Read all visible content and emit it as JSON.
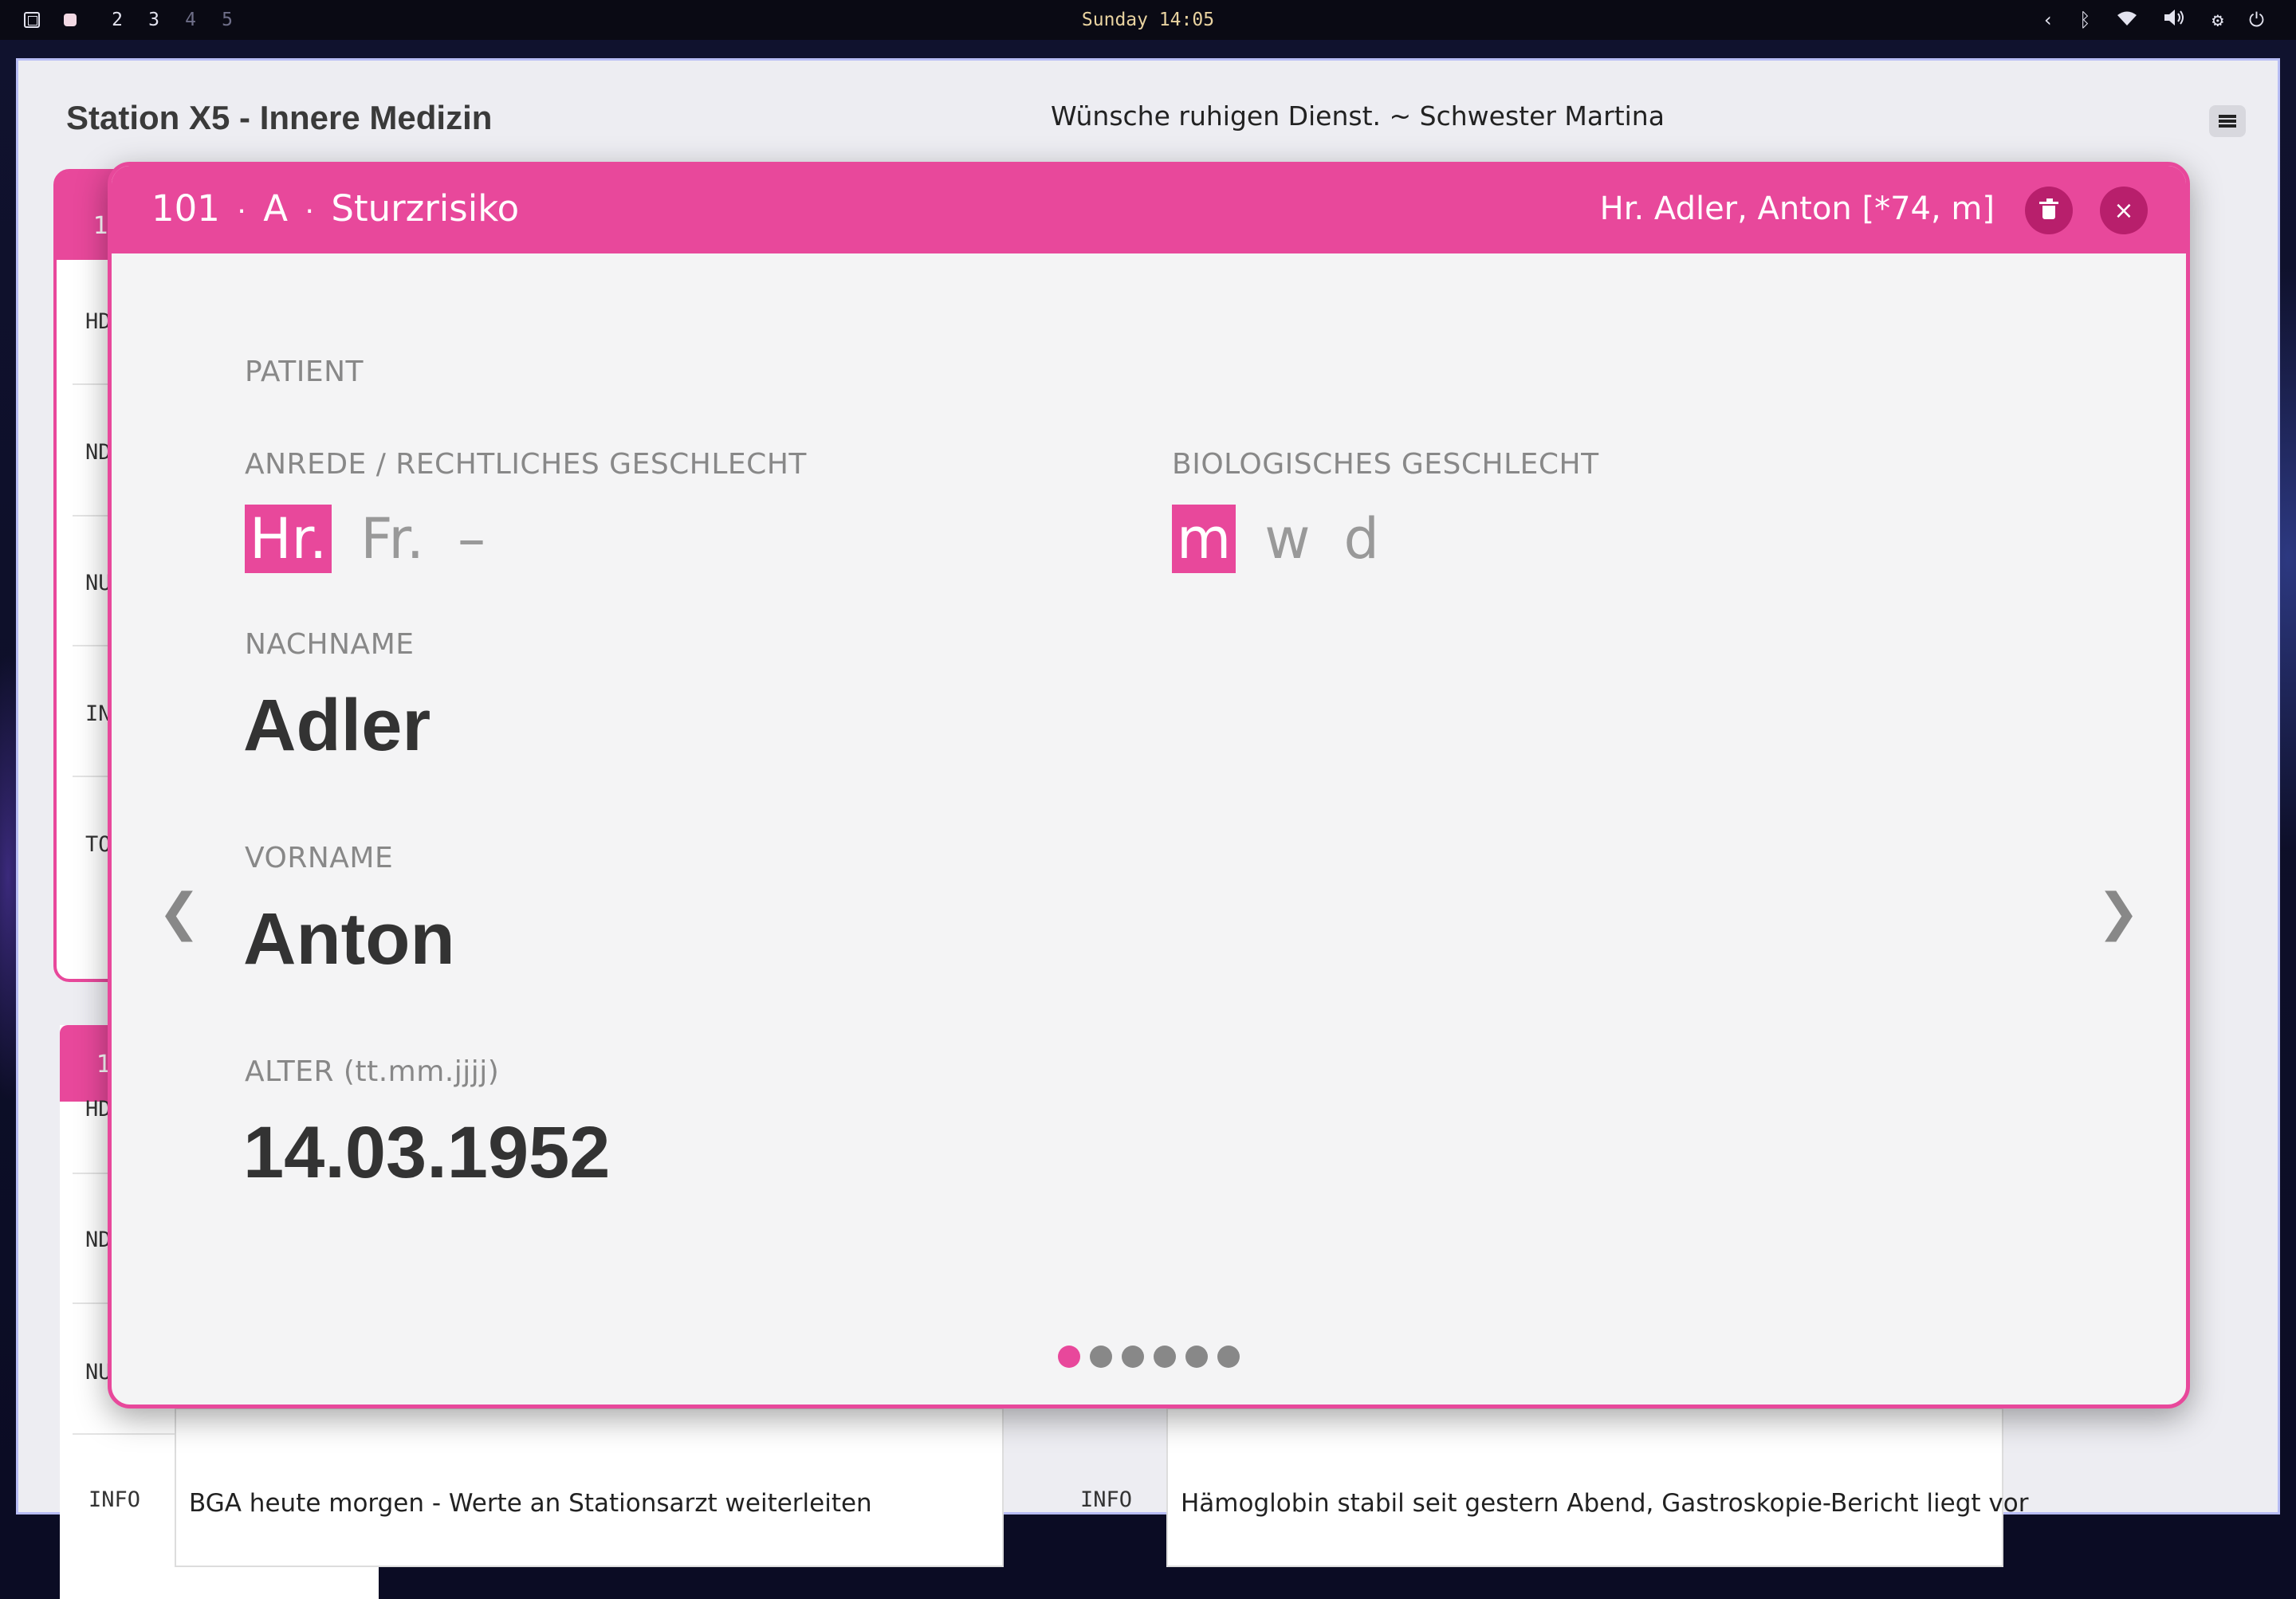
{
  "topbar": {
    "workspaces": [
      "2",
      "3",
      "4",
      "5"
    ],
    "clock": "Sunday 14:05",
    "tray_icons": [
      "chevron-left-icon",
      "bluetooth-icon",
      "wifi-icon",
      "volume-icon",
      "settings-icon",
      "power-icon"
    ]
  },
  "app": {
    "title": "Station X5 - Innere Medizin",
    "motto": "Wünsche ruhigen Dienst. ~ Schwester Martina"
  },
  "background_cards": {
    "card1": {
      "header": "1",
      "rows": [
        "HD",
        "ND",
        "NU",
        "IN",
        "TO"
      ]
    },
    "card2": {
      "header": "1",
      "rows": [
        "HD",
        "ND",
        "NU"
      ]
    },
    "notes": [
      {
        "label": "INFO",
        "text": "BGA heute morgen - Werte an Stationsarzt weiterleiten"
      },
      {
        "label": "INFO",
        "text": "Hämoglobin stabil seit gestern Abend, Gastroskopie-Bericht liegt vor"
      }
    ]
  },
  "modal": {
    "room": "101",
    "bed": "A",
    "tag": "Sturzrisiko",
    "patient_summary": "Hr. Adler, Anton [*74, m]",
    "section_title": "PATIENT",
    "salutation": {
      "label": "ANREDE / RECHTLICHES GESCHLECHT",
      "options": [
        "Hr.",
        "Fr.",
        "–"
      ],
      "selected": "Hr."
    },
    "bio_sex": {
      "label": "BIOLOGISCHES GESCHLECHT",
      "options": [
        "m",
        "w",
        "d"
      ],
      "selected": "m"
    },
    "lastname": {
      "label": "NACHNAME",
      "value": "Adler"
    },
    "firstname": {
      "label": "VORNAME",
      "value": "Anton"
    },
    "birthdate": {
      "label": "ALTER (tt.mm.jjjj)",
      "value": "14.03.1952"
    },
    "prev_arrow": "❮",
    "next_arrow": "❯",
    "close_glyph": "×",
    "page_count": 6,
    "active_page": 1
  },
  "colors": {
    "accent": "#e8489b",
    "accent_dark": "#b81f6c"
  }
}
